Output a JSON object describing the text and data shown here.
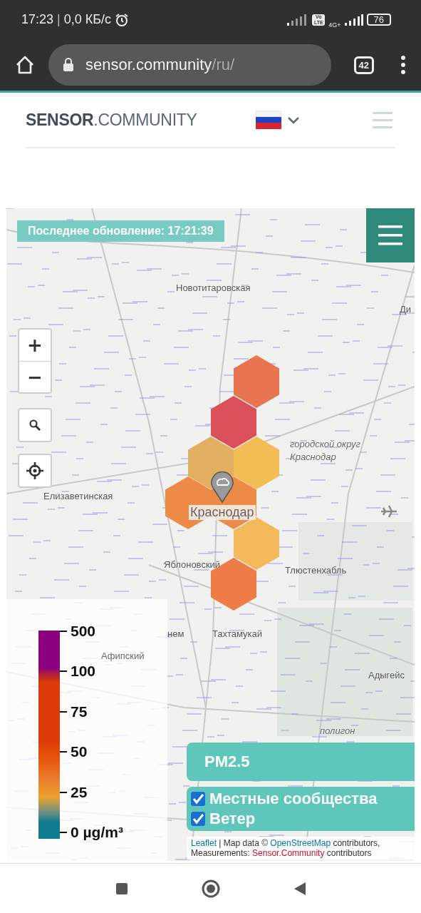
{
  "status_bar": {
    "time": "17:23",
    "separator": "|",
    "speed": "0,0 КБ/с",
    "volte": "Vo LTE",
    "network": "4G+",
    "battery": "76"
  },
  "browser": {
    "url_host": "sensor.community",
    "url_path": "/ru/",
    "tab_count": "42"
  },
  "header": {
    "logo": "**SENSOR**.COMMUNITY"
  },
  "map": {
    "last_update": "Последнее обновление: 17:21:39",
    "zoom_in": "+",
    "zoom_out": "−",
    "places": [
      {
        "text": "Новотитаровская",
        "kind": "town"
      },
      {
        "text": "Ди",
        "kind": "town"
      },
      {
        "text": "городской округ Краснодар",
        "kind": "district"
      },
      {
        "text": "Елизаветинская",
        "kind": "town"
      },
      {
        "text": "Краснодар",
        "kind": "city"
      },
      {
        "text": "Яблоновский",
        "kind": "town"
      },
      {
        "text": "Тлюстенхабль",
        "kind": "town"
      },
      {
        "text": "нем",
        "kind": "town"
      },
      {
        "text": "Тахтамукай",
        "kind": "town"
      },
      {
        "text": "Афипский",
        "kind": "faded"
      },
      {
        "text": "Адыгейс",
        "kind": "town"
      },
      {
        "text": "полигон",
        "kind": "district"
      }
    ],
    "hexagons": [
      {
        "color": "#e8754f"
      },
      {
        "color": "#d9505a"
      },
      {
        "color": "#e2b060"
      },
      {
        "color": "#f3bd55"
      },
      {
        "color": "#ee8a48"
      },
      {
        "color": "#ee8a48"
      },
      {
        "color": "#f3b95a"
      },
      {
        "color": "#ee7c47"
      }
    ],
    "legend": {
      "ticks": [
        "500",
        "100",
        "75",
        "50",
        "25",
        "0 µg/m³"
      ]
    },
    "pollutant": "PM2.5",
    "layers": [
      {
        "label": "Местные сообщества",
        "checked": true
      },
      {
        "label": "Ветер",
        "checked": true
      }
    ],
    "attribution": [
      [
        {
          "text": "Leaflet",
          "kind": "link"
        },
        {
          "text": " | Map data © ",
          "kind": "text"
        },
        {
          "text": "OpenStreetMap",
          "kind": "link"
        },
        {
          "text": " contributors,",
          "kind": "text"
        }
      ],
      [
        {
          "text": "Measurements: ",
          "kind": "text"
        },
        {
          "text": "Sensor.Community",
          "kind": "brand"
        },
        {
          "text": " contributors",
          "kind": "text"
        }
      ]
    ]
  }
}
